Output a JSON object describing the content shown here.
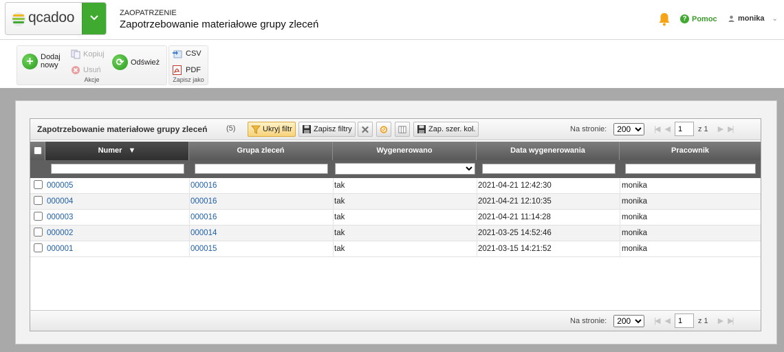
{
  "header": {
    "logo_text": "qcadoo",
    "breadcrumb_small": "ZAOPATRZENIE",
    "page_title": "Zapotrzebowanie materiałowe grupy zleceń",
    "help_label": "Pomoc",
    "user_label": "monika"
  },
  "ribbon": {
    "actions": {
      "caption": "Akcje",
      "add_new_line1": "Dodaj",
      "add_new_line2": "nowy",
      "copy": "Kopiuj",
      "delete": "Usuń",
      "refresh": "Odśwież"
    },
    "export": {
      "caption": "Zapisz jako",
      "csv": "CSV",
      "pdf": "PDF"
    }
  },
  "grid": {
    "title": "Zapotrzebowanie materiałowe grupy zleceń",
    "count": "(5)",
    "toolbar": {
      "hide_filter": "Ukryj filtr",
      "save_filters": "Zapisz filtry",
      "save_col_widths": "Zap. szer. kol."
    },
    "pager": {
      "per_page_label": "Na stronie:",
      "per_page_value": "200",
      "page_value": "1",
      "of_label": "z 1"
    },
    "columns": [
      "Numer",
      "Grupa zleceń",
      "Wygenerowano",
      "Data wygenerowania",
      "Pracownik"
    ],
    "rows": [
      {
        "number": "000005",
        "group": "000016",
        "generated": "tak",
        "date": "2021-04-21 12:42:30",
        "worker": "monika"
      },
      {
        "number": "000004",
        "group": "000016",
        "generated": "tak",
        "date": "2021-04-21 12:10:35",
        "worker": "monika"
      },
      {
        "number": "000003",
        "group": "000016",
        "generated": "tak",
        "date": "2021-04-21 11:14:28",
        "worker": "monika"
      },
      {
        "number": "000002",
        "group": "000014",
        "generated": "tak",
        "date": "2021-03-25 14:52:46",
        "worker": "monika"
      },
      {
        "number": "000001",
        "group": "000015",
        "generated": "tak",
        "date": "2021-03-15 14:21:52",
        "worker": "monika"
      }
    ]
  },
  "colors": {
    "brand_green": "#3faa2f",
    "link_blue": "#1f5fa6",
    "header_dark": "#595959"
  }
}
